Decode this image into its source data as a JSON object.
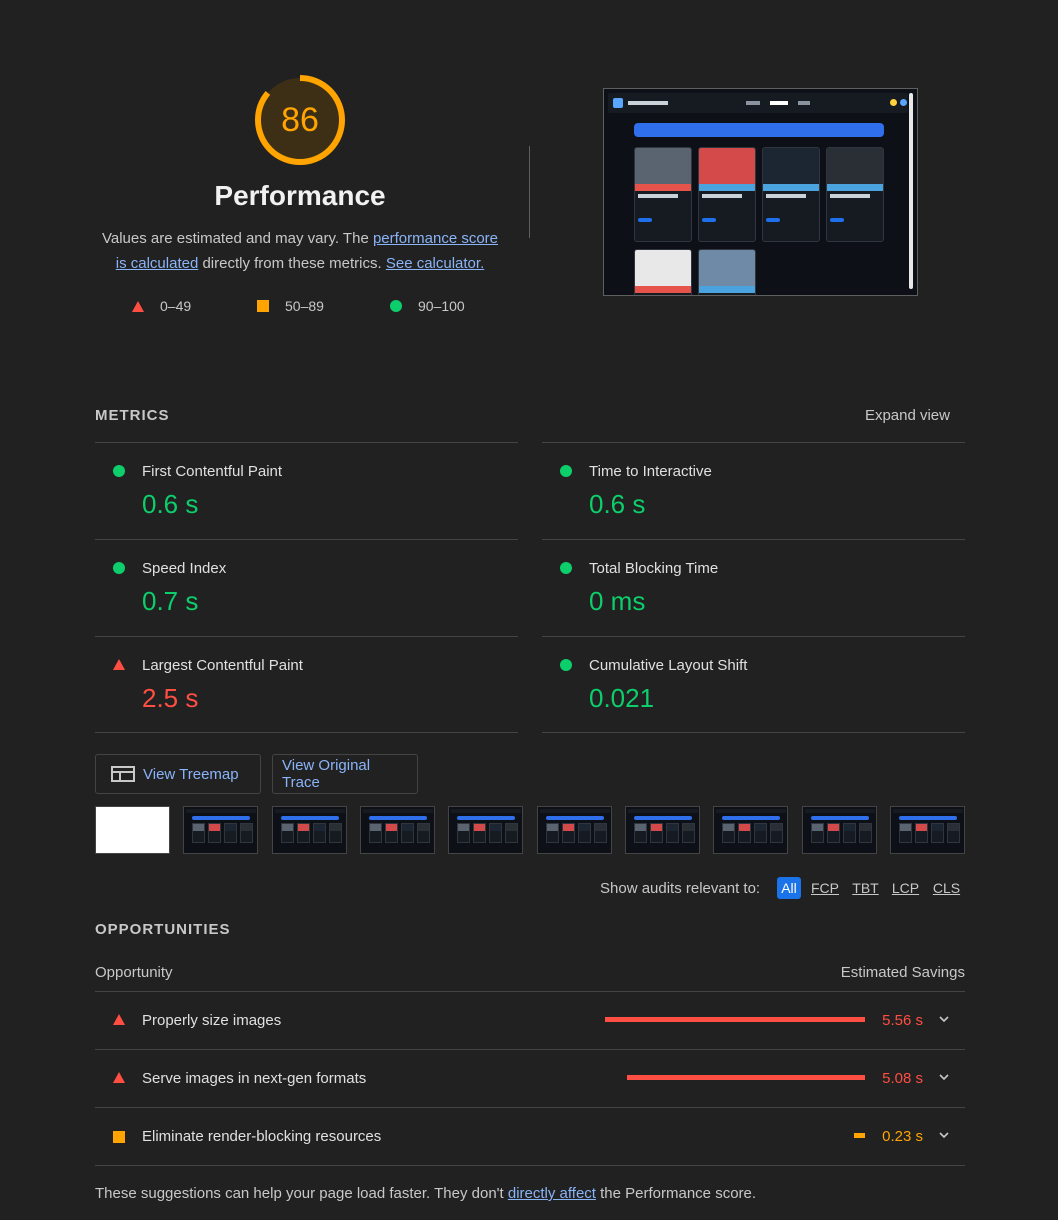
{
  "gauge": {
    "score": "86",
    "fraction": 0.86,
    "color": "#ffa400"
  },
  "title": "Performance",
  "description": {
    "part1": "Values are estimated and may vary. The ",
    "link1": "performance score is calculated",
    "part2": " directly from these metrics. ",
    "link2": "See calculator."
  },
  "legend": {
    "fail": "0–49",
    "average": "50–89",
    "pass": "90–100"
  },
  "metrics": {
    "title": "METRICS",
    "expand": "Expand view",
    "items": [
      {
        "name": "First Contentful Paint",
        "value": "0.6 s",
        "status": "pass"
      },
      {
        "name": "Time to Interactive",
        "value": "0.6 s",
        "status": "pass"
      },
      {
        "name": "Speed Index",
        "value": "0.7 s",
        "status": "pass"
      },
      {
        "name": "Total Blocking Time",
        "value": "0 ms",
        "status": "pass"
      },
      {
        "name": "Largest Contentful Paint",
        "value": "2.5 s",
        "status": "fail"
      },
      {
        "name": "Cumulative Layout Shift",
        "value": "0.021",
        "status": "pass"
      }
    ]
  },
  "buttons": {
    "treemap": "View Treemap",
    "trace": "View Original Trace"
  },
  "filter": {
    "label": "Show audits relevant to:",
    "options": [
      "All",
      "FCP",
      "TBT",
      "LCP",
      "CLS"
    ],
    "active": "All"
  },
  "opportunities": {
    "title": "OPPORTUNITIES",
    "col_opportunity": "Opportunity",
    "col_savings": "Estimated Savings",
    "items": [
      {
        "name": "Properly size images",
        "savings": "5.56 s",
        "savings_value": 5.56,
        "status": "fail"
      },
      {
        "name": "Serve images in next-gen formats",
        "savings": "5.08 s",
        "savings_value": 5.08,
        "status": "fail"
      },
      {
        "name": "Eliminate render-blocking resources",
        "savings": "0.23 s",
        "savings_value": 0.23,
        "status": "average"
      }
    ]
  },
  "footer": {
    "part1": "These suggestions can help your page load faster. They don't ",
    "link": "directly affect",
    "part2": " the Performance score."
  },
  "colors": {
    "pass": "#0cce6b",
    "average": "#ffa400",
    "fail": "#ff4e42",
    "link": "#8ab4f8"
  }
}
